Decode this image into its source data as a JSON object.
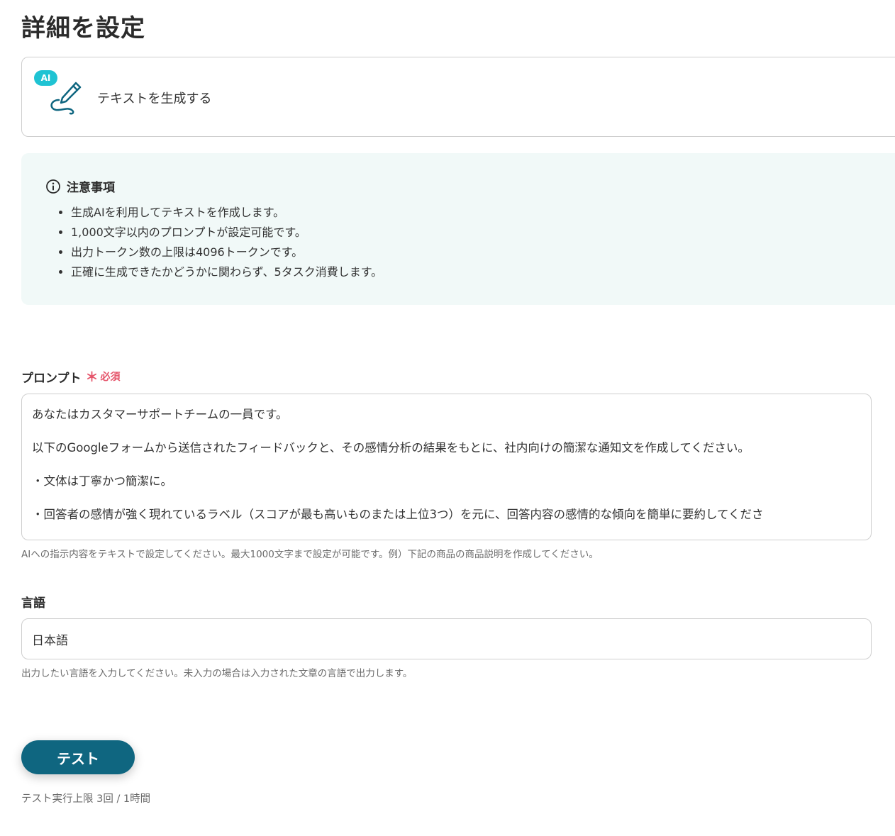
{
  "page_title": "詳細を設定",
  "action": {
    "badge": "AI",
    "title": "テキストを生成する",
    "icon": "pen-icon"
  },
  "notice": {
    "title": "注意事項",
    "icon": "info-icon",
    "items": [
      "生成AIを利用してテキストを作成します。",
      "1,000文字以内のプロンプトが設定可能です。",
      "出力トークン数の上限は4096トークンです。",
      "正確に生成できたかどうかに関わらず、5タスク消費します。"
    ]
  },
  "prompt": {
    "label": "プロンプト",
    "required_mark": "＊",
    "required_text": "必須",
    "lines": [
      "あなたはカスタマーサポートチームの一員です。",
      "以下のGoogleフォームから送信されたフィードバックと、その感情分析の結果をもとに、社内向けの簡潔な通知文を作成してください。",
      "・文体は丁寧かつ簡潔に。",
      "・回答者の感情が強く現れているラベル（スコアが最も高いものまたは上位3つ）を元に、回答内容の感情的な傾向を簡単に要約してくださ"
    ],
    "helper": "AIへの指示内容をテキストで設定してください。最大1000文字まで設定が可能です。例）下記の商品の商品説明を作成してください。"
  },
  "language": {
    "label": "言語",
    "value": "日本語",
    "helper": "出力したい言語を入力してください。未入力の場合は入力された文章の言語で出力します。"
  },
  "test": {
    "button_label": "テスト",
    "limit": "テスト実行上限 3回 / 1時間"
  },
  "colors": {
    "primary": "#0f6680",
    "ai_badge": "#1fc3d3",
    "required": "#e5546a",
    "notice_bg": "#f1f9f8"
  }
}
